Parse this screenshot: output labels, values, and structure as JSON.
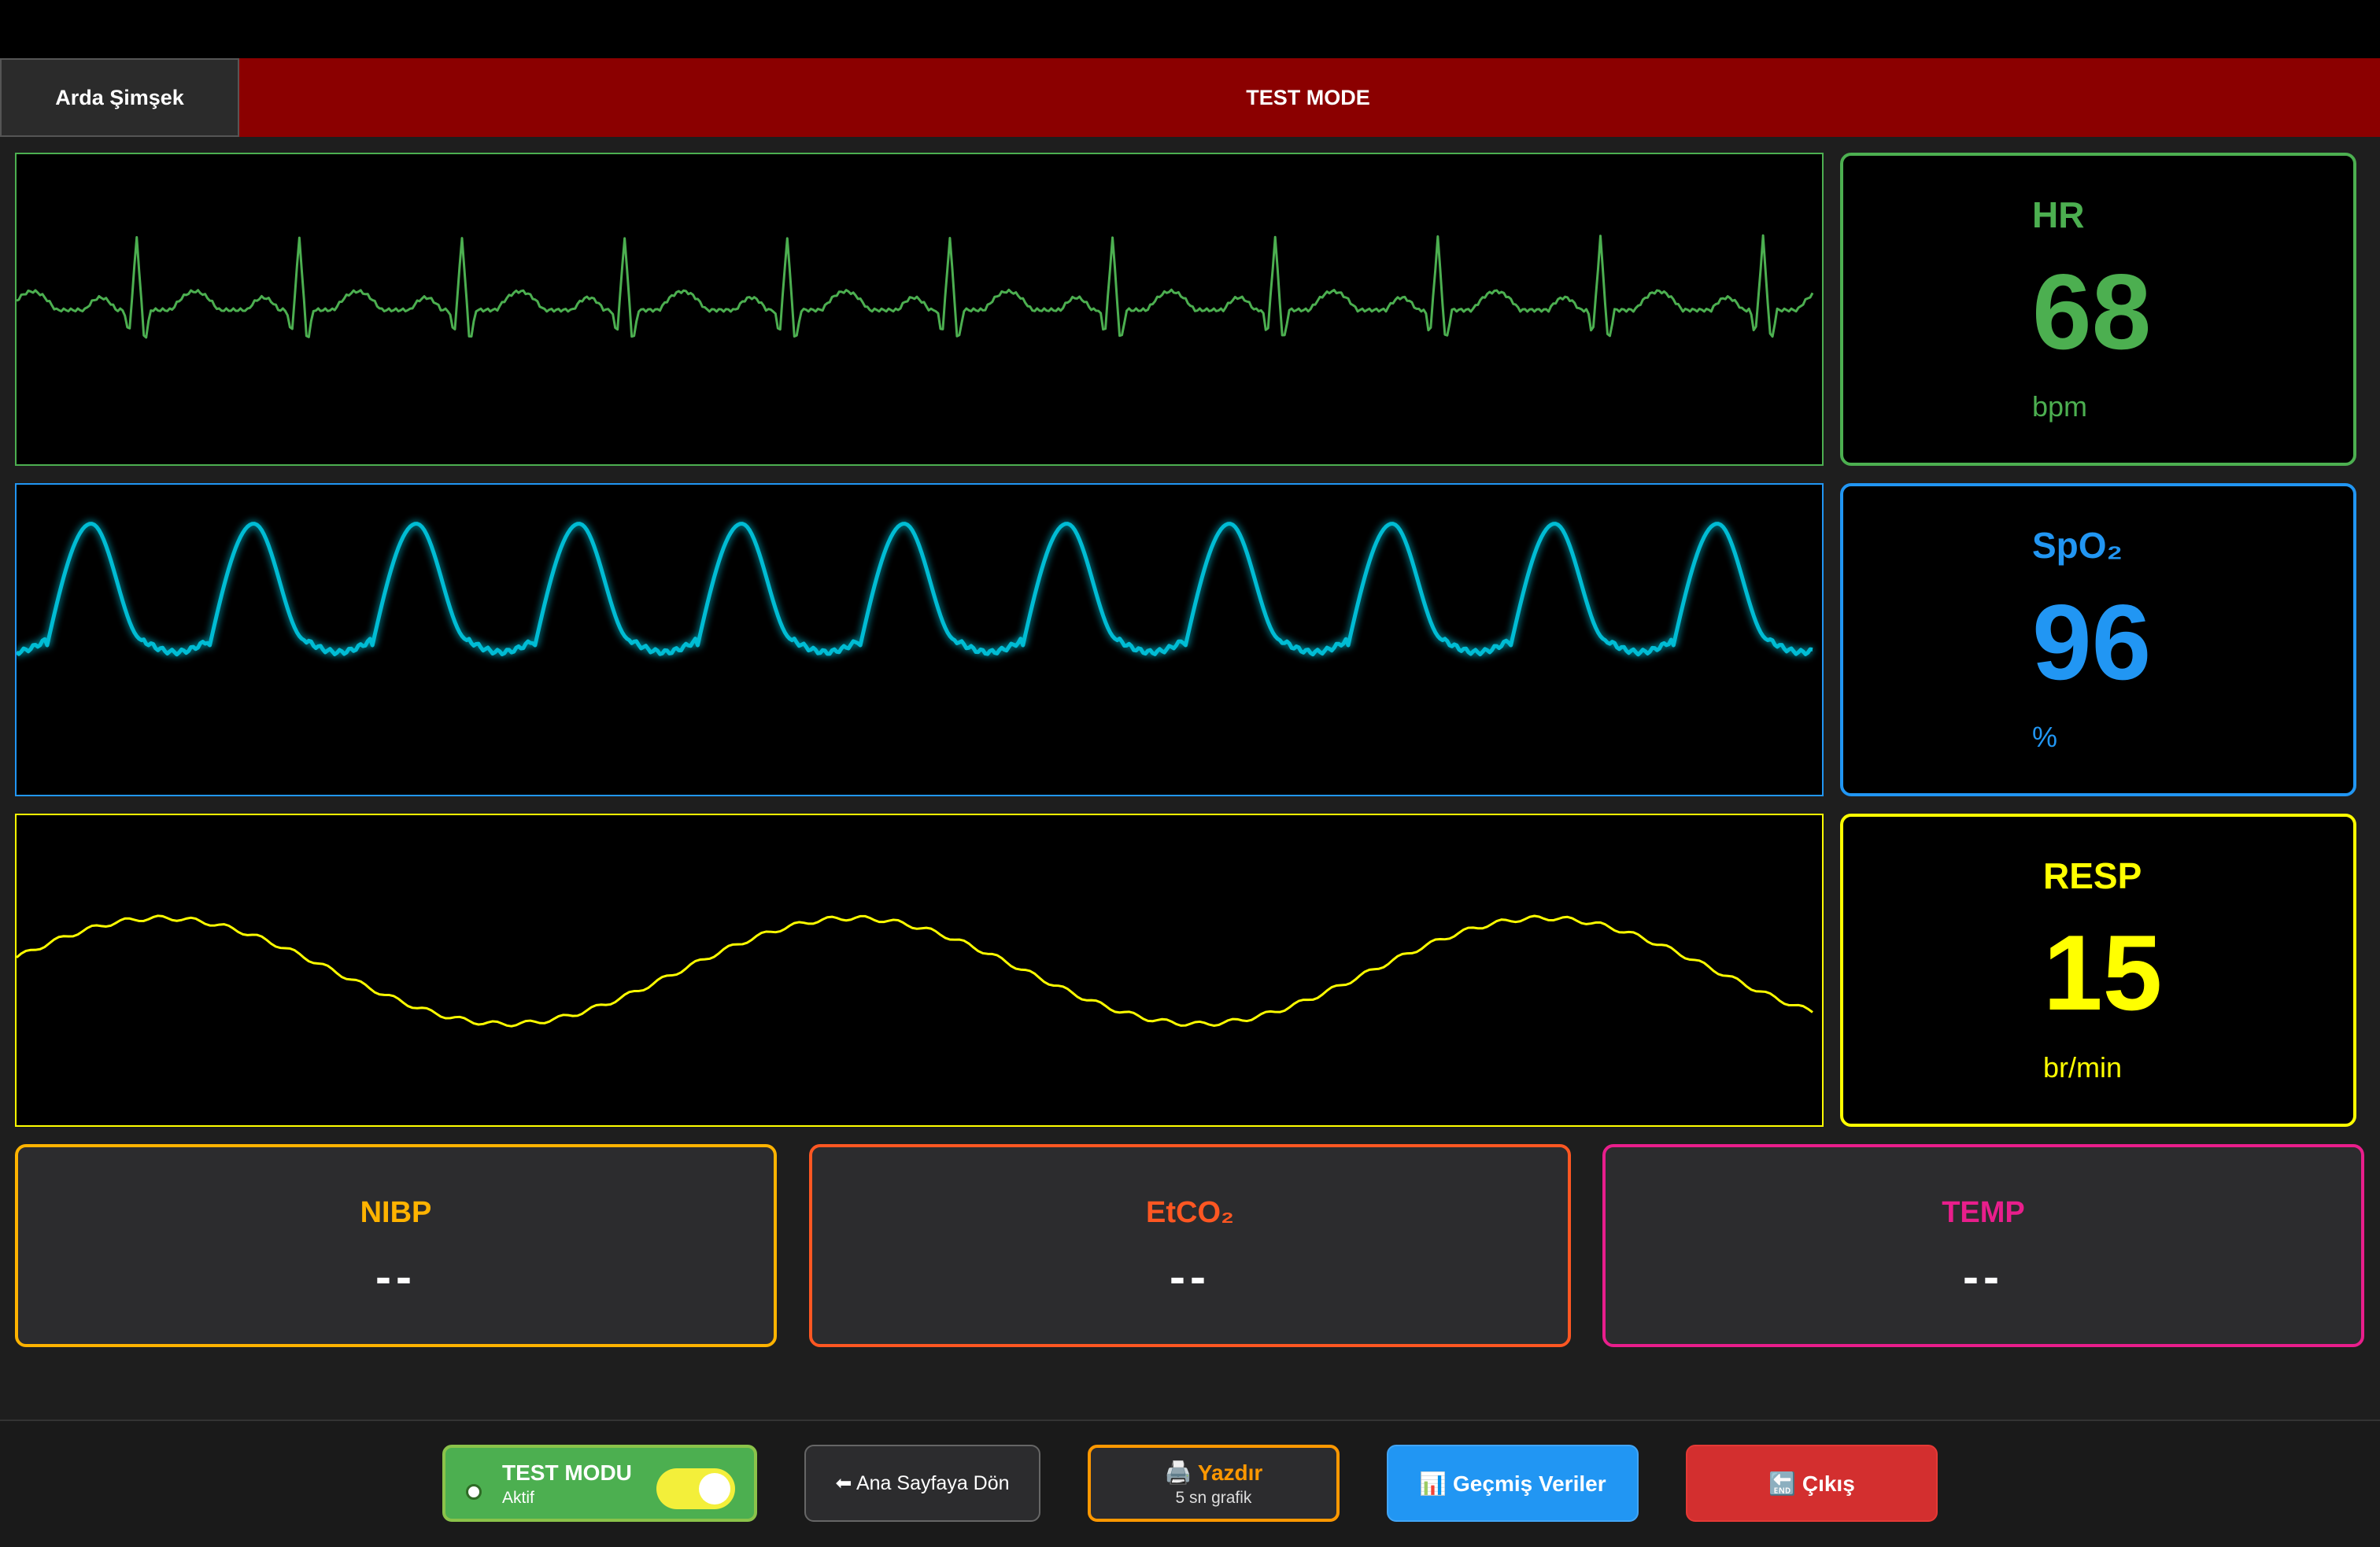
{
  "header": {
    "user_name": "Arda Şimşek",
    "mode_title": "TEST MODE",
    "color": "#8b0000"
  },
  "vitals": {
    "hr": {
      "label": "HR",
      "value": "68",
      "unit": "bpm",
      "color": "#4caf50"
    },
    "spo2": {
      "label": "SpO₂",
      "value": "96",
      "unit": "%",
      "color": "#2196f3"
    },
    "resp": {
      "label": "RESP",
      "value": "15",
      "unit": "br/min",
      "color": "#ffff00"
    }
  },
  "waveforms": {
    "ecg": {
      "color": "#4caf50",
      "icon": "ecg-wave"
    },
    "pleth": {
      "color": "#00bcd4",
      "icon": "pleth-wave"
    },
    "resp": {
      "color": "#ffff00",
      "icon": "resp-wave"
    }
  },
  "secondary": {
    "nibp": {
      "label": "NIBP",
      "value": "--",
      "color": "#ffb300"
    },
    "etco2": {
      "label": "EtCO₂",
      "value": "--",
      "color": "#ff5722"
    },
    "temp": {
      "label": "TEMP",
      "value": "--",
      "color": "#e91e8c"
    }
  },
  "footer": {
    "test_mode": {
      "label": "TEST MODU",
      "status": "Aktif",
      "enabled": true,
      "color": "#4caf50"
    },
    "home": {
      "label": "⬅ Ana Sayfaya Dön",
      "icon": "arrow-left-icon"
    },
    "print": {
      "label": "🖨️ Yazdır",
      "sub": "5 sn grafik",
      "icon": "printer-icon",
      "color": "#ff9800"
    },
    "history": {
      "label": "📊 Geçmiş Veriler",
      "icon": "chart-icon",
      "color": "#2196f3"
    },
    "exit": {
      "label": "🔚 Çıkış",
      "icon": "end-icon",
      "color": "#d32f2f"
    }
  }
}
